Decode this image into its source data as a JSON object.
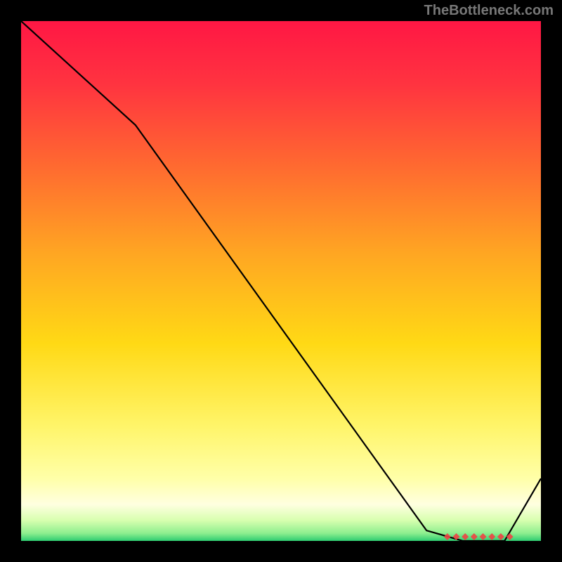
{
  "watermark": "TheBottleneck.com",
  "chart_data": {
    "type": "line",
    "x": [
      0,
      22,
      78,
      85,
      93,
      100
    ],
    "values": [
      100,
      80,
      2,
      0,
      0,
      12
    ],
    "title": "",
    "xlabel": "",
    "ylabel": "",
    "xlim": [
      0,
      100
    ],
    "ylim": [
      0,
      100
    ],
    "background_gradient": {
      "stops": [
        {
          "offset": 0.0,
          "color": "#ff1744"
        },
        {
          "offset": 0.12,
          "color": "#ff3340"
        },
        {
          "offset": 0.28,
          "color": "#ff6a30"
        },
        {
          "offset": 0.45,
          "color": "#ffa722"
        },
        {
          "offset": 0.62,
          "color": "#ffd915"
        },
        {
          "offset": 0.78,
          "color": "#fff56a"
        },
        {
          "offset": 0.88,
          "color": "#ffffa8"
        },
        {
          "offset": 0.93,
          "color": "#ffffe0"
        },
        {
          "offset": 0.96,
          "color": "#d8ffb0"
        },
        {
          "offset": 0.985,
          "color": "#8fef8f"
        },
        {
          "offset": 1.0,
          "color": "#2ecc71"
        }
      ]
    },
    "markers": {
      "x_range": [
        82,
        94
      ],
      "count": 8,
      "color": "#ef4444",
      "shape": "diamond"
    }
  }
}
